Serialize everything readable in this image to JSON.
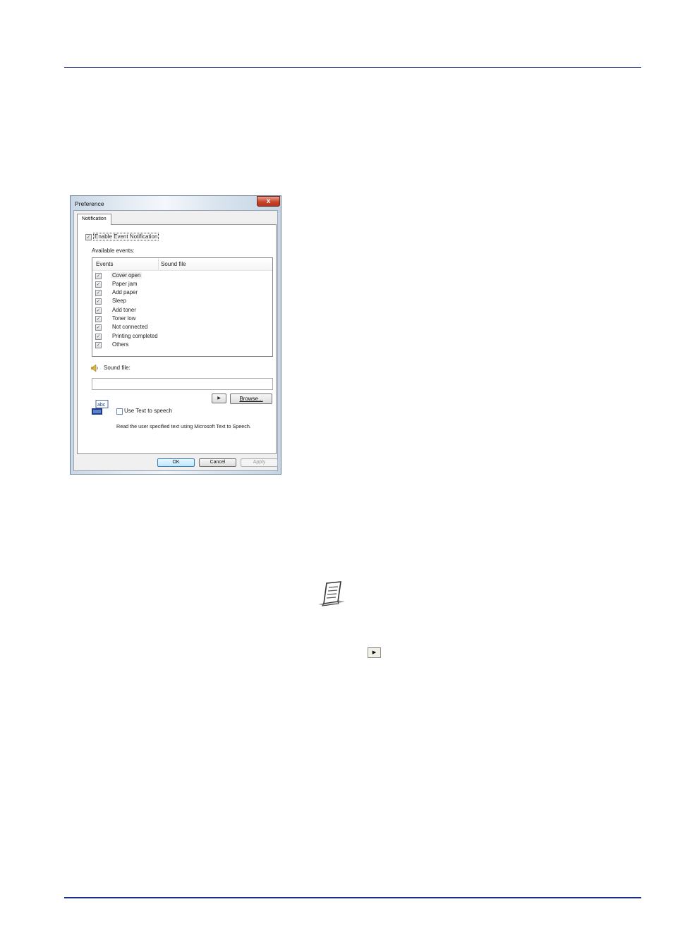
{
  "dialog": {
    "title": "Preference",
    "close_label": "x",
    "tab_label": "Notification",
    "enable_label": "Enable Event Notification",
    "available_events_label": "Available events:",
    "columns": {
      "events": "Events",
      "sound_file": "Sound file"
    },
    "events": [
      {
        "label": "Cover open",
        "checked": true
      },
      {
        "label": "Paper jam",
        "checked": true
      },
      {
        "label": "Add paper",
        "checked": true
      },
      {
        "label": "Sleep",
        "checked": true
      },
      {
        "label": "Add toner",
        "checked": true
      },
      {
        "label": "Toner low",
        "checked": true
      },
      {
        "label": "Not connected",
        "checked": true
      },
      {
        "label": "Printing completed",
        "checked": true
      },
      {
        "label": "Others",
        "checked": true
      }
    ],
    "sound_file_label": "Sound file:",
    "sound_file_value": "",
    "play_icon": "play-icon",
    "browse_label": "Browse...",
    "tts_icon_text": "abc",
    "tts_checkbox_label": "Use Text to speech",
    "tts_checked": false,
    "tts_description": "Read the user specified text using Microsoft Text to Speech.",
    "ok_label": "OK",
    "cancel_label": "Cancel",
    "apply_label": "Apply"
  },
  "page": {
    "rule_color": "#1a2d8c",
    "note_icon": "note-icon",
    "inline_arrow_icon": "play-icon"
  }
}
